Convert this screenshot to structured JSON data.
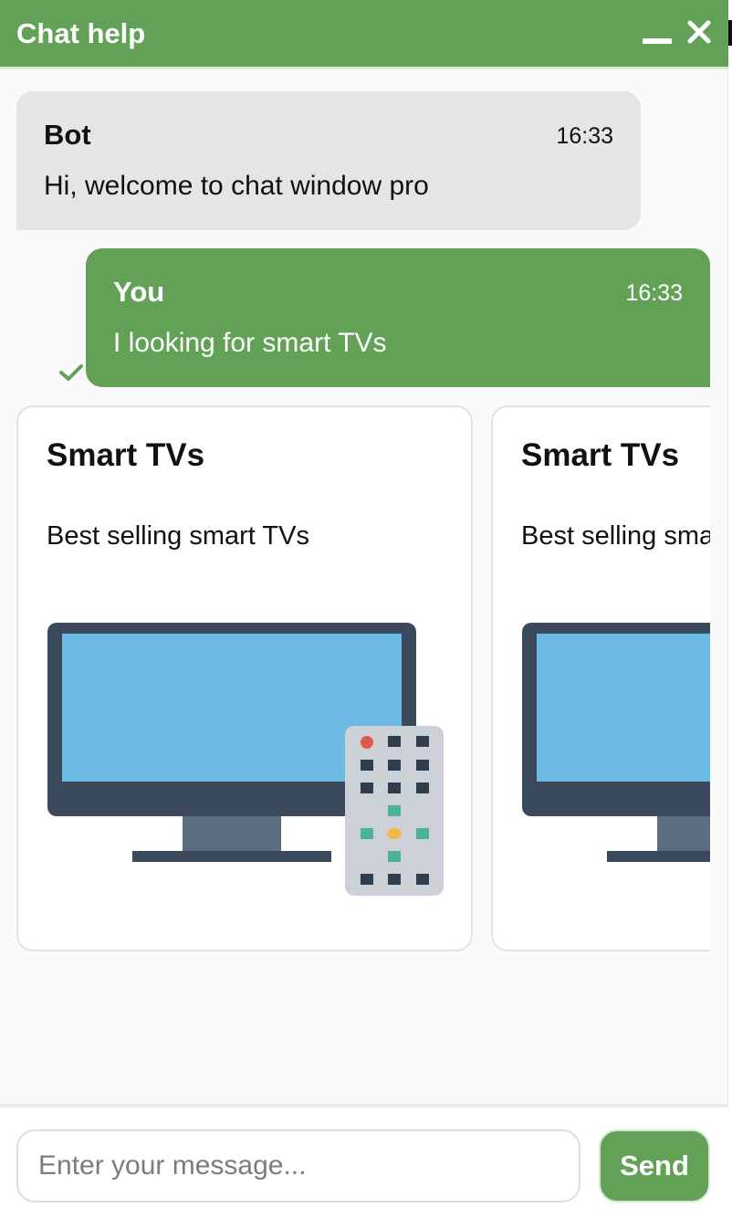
{
  "header": {
    "title": "Chat help",
    "minimize_icon": "minimize-icon",
    "close_icon": "close-icon",
    "color": "#63a157"
  },
  "messages": [
    {
      "sender": "Bot",
      "time": "16:33",
      "text": "Hi, welcome to chat window pro",
      "bubble_color": "#e3e6e2"
    },
    {
      "sender": "You",
      "time": "16:33",
      "text": "I looking for smart TVs",
      "bubble_color": "#63a157",
      "status_icon": "checkmark-icon"
    }
  ],
  "carousel": {
    "cards": [
      {
        "title": "Smart TVs",
        "description": "Best selling smart TVs",
        "image_icon": "tv-with-remote-icon"
      },
      {
        "title": "Smart TVs",
        "description": "Best selling smart TVs",
        "image_icon": "tv-with-remote-icon"
      }
    ]
  },
  "composer": {
    "placeholder": "Enter your message...",
    "value": "",
    "send_label": "Send"
  },
  "colors": {
    "accent": "#63a157",
    "bot_bubble": "#e3e6e2",
    "tv_screen": "#6bbbe4",
    "tv_frame": "#3a4a5c",
    "remote_body": "#ccd1d8"
  }
}
